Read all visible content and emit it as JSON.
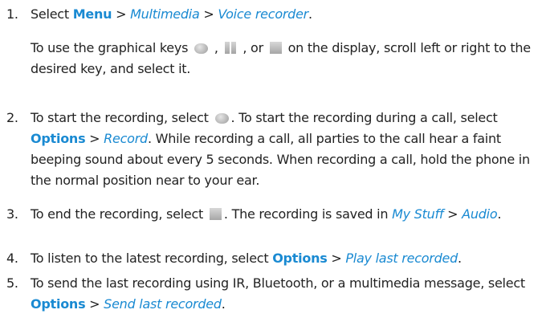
{
  "steps": [
    {
      "num": "1.",
      "t1": "Select ",
      "menu": "Menu",
      "sep1": " > ",
      "multimedia": "Multimedia",
      "sep2": " > ",
      "voice_recorder": "Voice recorder",
      "end": ".",
      "note_a": "To use the graphical keys ",
      "note_b": " , ",
      "note_c": " , or ",
      "note_d": " on the display, scroll left or right to the desired key, and select it."
    },
    {
      "num": "2.",
      "t1": "To start the recording, select ",
      "t2": ". To start the recording during a call, select ",
      "options": "Options",
      "sep": " > ",
      "record": "Record",
      "t3": ". While recording a call, all parties to the call hear a faint beeping sound about every 5 seconds. When recording a call, hold the phone in the normal position near to your ear."
    },
    {
      "num": "3.",
      "t1": "To end the recording, select ",
      "t2": ". The recording is saved in ",
      "my_stuff": "My Stuff",
      "sep": " > ",
      "audio": "Audio",
      "end": "."
    },
    {
      "num": "4.",
      "t1": "To listen to the latest recording, select ",
      "options": "Options",
      "sep": " > ",
      "play_last": "Play last recorded",
      "end": "."
    },
    {
      "num": "5.",
      "t1": "To send the last recording using IR, Bluetooth, or a multimedia message, select ",
      "options": "Options",
      "sep": " > ",
      "send_last": "Send last recorded",
      "end": "."
    }
  ],
  "icons": [
    "record-icon",
    "pause-icon",
    "stop-icon"
  ],
  "colors": {
    "text": "#222222",
    "link": "#1a8ad2"
  }
}
